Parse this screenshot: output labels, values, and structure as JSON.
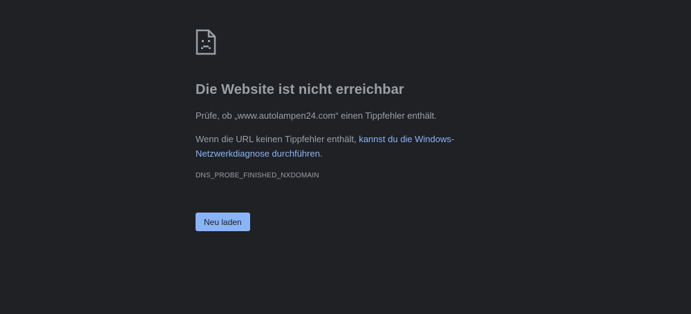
{
  "error_page": {
    "icon": "sad-page-icon",
    "title": "Die Website ist nicht erreichbar",
    "check_text": "Prüfe, ob „www.autolampen24.com“ einen Tippfehler enthält.",
    "suggestion_prefix": "Wenn die URL keinen Tippfehler enthält,",
    "suggestion_link": "kannst du die Windows-Netzwerkdiagnose durchführen",
    "suggestion_suffix": ".",
    "error_code": "DNS_PROBE_FINISHED_NXDOMAIN",
    "reload_label": "Neu laden"
  },
  "colors": {
    "background": "#202124",
    "text": "#9aa0a6",
    "link": "#8ab4f8",
    "button": "#8ab4f8"
  }
}
